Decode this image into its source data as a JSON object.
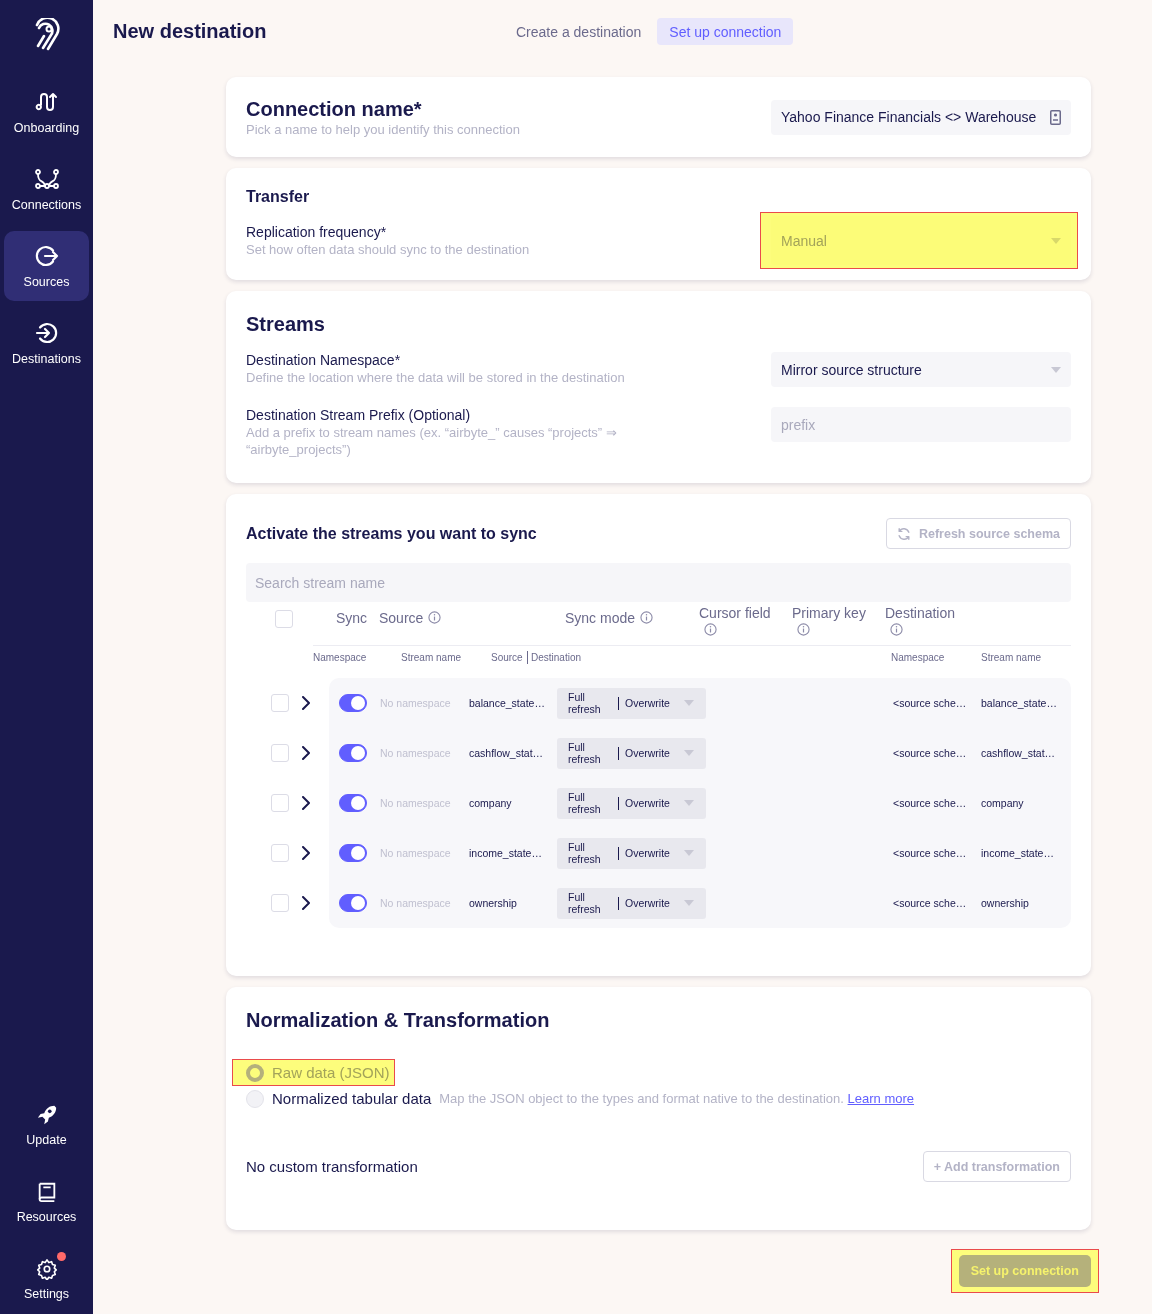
{
  "sidebar": {
    "items": [
      {
        "label": "Onboarding",
        "selected": false
      },
      {
        "label": "Connections",
        "selected": false
      },
      {
        "label": "Sources",
        "selected": true
      },
      {
        "label": "Destinations",
        "selected": false
      }
    ],
    "bottom_items": [
      {
        "label": "Update",
        "notification": false
      },
      {
        "label": "Resources",
        "notification": false
      },
      {
        "label": "Settings",
        "notification": true
      }
    ]
  },
  "header": {
    "title": "New destination",
    "steps": [
      {
        "label": "Create a destination",
        "selected": false
      },
      {
        "label": "Set up connection",
        "selected": true
      }
    ]
  },
  "connection_name": {
    "title": "Connection name*",
    "hint": "Pick a name to help you identify this connection",
    "value": "Yahoo Finance Financials <> Warehouse"
  },
  "transfer": {
    "title": "Transfer",
    "frequency": {
      "label": "Replication frequency*",
      "hint": "Set how often data should sync to the destination",
      "value": "Manual",
      "highlighted": true
    }
  },
  "streams_settings": {
    "title": "Streams",
    "namespace": {
      "label": "Destination Namespace*",
      "hint": "Define the location where the data will be stored in the destination",
      "value": "Mirror source structure"
    },
    "prefix": {
      "label": "Destination Stream Prefix (Optional)",
      "hint": "Add a prefix to stream names (ex. “airbyte_” causes “projects” ⇒ “airbyte_projects”)",
      "placeholder": "prefix"
    }
  },
  "streams_table": {
    "title": "Activate the streams you want to sync",
    "refresh_button": "Refresh source schema",
    "search_placeholder": "Search stream name",
    "select_all_checked": false,
    "columns": [
      {
        "label": "Sync",
        "info": false
      },
      {
        "label": "Source",
        "info": true
      },
      {
        "label": "Sync mode",
        "info": true
      },
      {
        "label": "Cursor field",
        "info": true
      },
      {
        "label": "Primary key",
        "info": true
      },
      {
        "label": "Destination",
        "info": true
      }
    ],
    "subcolumns": [
      "Namespace",
      "Stream name",
      "Source",
      "Destination",
      "Namespace",
      "Stream name"
    ],
    "rows": [
      {
        "checked": false,
        "enabled": true,
        "namespace": "No namespace",
        "stream": "balance_state…",
        "sync_source": "Full refresh",
        "sync_destination": "Overwrite",
        "dest_namespace": "<source sche…",
        "dest_stream": "balance_state…"
      },
      {
        "checked": false,
        "enabled": true,
        "namespace": "No namespace",
        "stream": "cashflow_stat…",
        "sync_source": "Full refresh",
        "sync_destination": "Overwrite",
        "dest_namespace": "<source sche…",
        "dest_stream": "cashflow_stat…"
      },
      {
        "checked": false,
        "enabled": true,
        "namespace": "No namespace",
        "stream": "company",
        "sync_source": "Full refresh",
        "sync_destination": "Overwrite",
        "dest_namespace": "<source sche…",
        "dest_stream": "company"
      },
      {
        "checked": false,
        "enabled": true,
        "namespace": "No namespace",
        "stream": "income_state…",
        "sync_source": "Full refresh",
        "sync_destination": "Overwrite",
        "dest_namespace": "<source sche…",
        "dest_stream": "income_state…"
      },
      {
        "checked": false,
        "enabled": true,
        "namespace": "No namespace",
        "stream": "ownership",
        "sync_source": "Full refresh",
        "sync_destination": "Overwrite",
        "dest_namespace": "<source sche…",
        "dest_stream": "ownership"
      }
    ]
  },
  "normalization": {
    "title": "Normalization & Transformation",
    "options": [
      {
        "label": "Raw data (JSON)",
        "selected": true,
        "highlighted": true
      },
      {
        "label": "Normalized tabular data",
        "description": "Map the JSON object to the types and format native to the destination.",
        "link": "Learn more",
        "selected": false,
        "highlighted": false
      }
    ],
    "transformation_text": "No custom transformation",
    "add_button": "+ Add transformation"
  },
  "submit": {
    "label": "Set up connection",
    "highlighted": true
  }
}
